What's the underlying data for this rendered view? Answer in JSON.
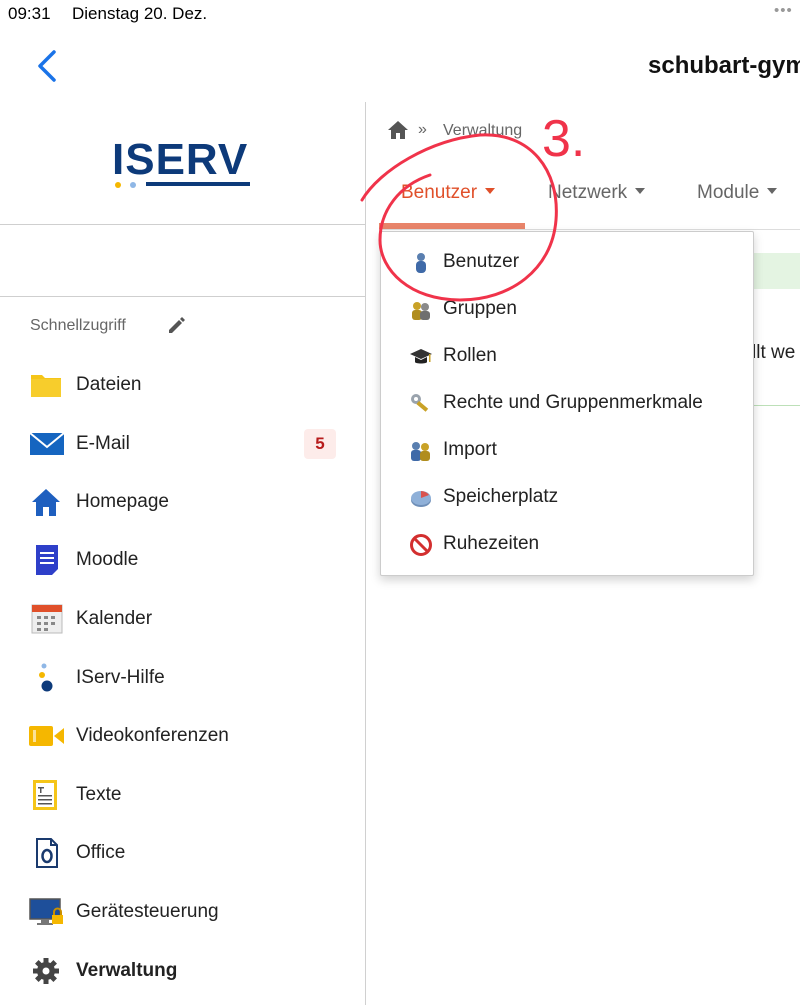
{
  "status_bar": {
    "time": "09:31",
    "date": "Dienstag 20. Dez.",
    "dots": "•••"
  },
  "header": {
    "site_title": "schubart-gym"
  },
  "sidebar": {
    "logo_text": "ISERV",
    "quick_access_label": "Schnellzugriff",
    "items": [
      {
        "label": "Dateien",
        "icon": "folder-icon"
      },
      {
        "label": "E-Mail",
        "icon": "mail-icon",
        "badge": "5"
      },
      {
        "label": "Homepage",
        "icon": "home-icon"
      },
      {
        "label": "Moodle",
        "icon": "document-icon"
      },
      {
        "label": "Kalender",
        "icon": "calendar-icon"
      },
      {
        "label": "IServ-Hilfe",
        "icon": "help-dots-icon"
      },
      {
        "label": "Videokonferenzen",
        "icon": "video-camera-icon"
      },
      {
        "label": "Texte",
        "icon": "text-notepad-icon"
      },
      {
        "label": "Office",
        "icon": "office-icon"
      },
      {
        "label": "Gerätesteuerung",
        "icon": "monitor-lock-icon"
      },
      {
        "label": "Verwaltung",
        "icon": "gear-icon",
        "active": true
      }
    ]
  },
  "breadcrumb": {
    "separator": "»",
    "item": "Verwaltung"
  },
  "tabs": [
    {
      "label": "Benutzer",
      "active": true
    },
    {
      "label": "Netzwerk"
    },
    {
      "label": "Module"
    }
  ],
  "background_content": {
    "text_fragment": "llt we"
  },
  "dropdown": {
    "items": [
      {
        "label": "Benutzer",
        "icon": "user-icon"
      },
      {
        "label": "Gruppen",
        "icon": "group-icon"
      },
      {
        "label": "Rollen",
        "icon": "graduation-cap-icon"
      },
      {
        "label": "Rechte und Gruppenmerkmale",
        "icon": "key-icon"
      },
      {
        "label": "Import",
        "icon": "import-users-icon"
      },
      {
        "label": "Speicherplatz",
        "icon": "disk-space-icon"
      },
      {
        "label": "Ruhezeiten",
        "icon": "no-entry-icon"
      }
    ]
  },
  "annotation": {
    "text": "3.",
    "color": "#f0334a"
  },
  "colors": {
    "accent": "#e0502a",
    "link_blue": "#1a73e8",
    "iserv_navy": "#0d3a7a",
    "badge_bg": "#fdecea",
    "badge_text": "#b71c1c"
  }
}
